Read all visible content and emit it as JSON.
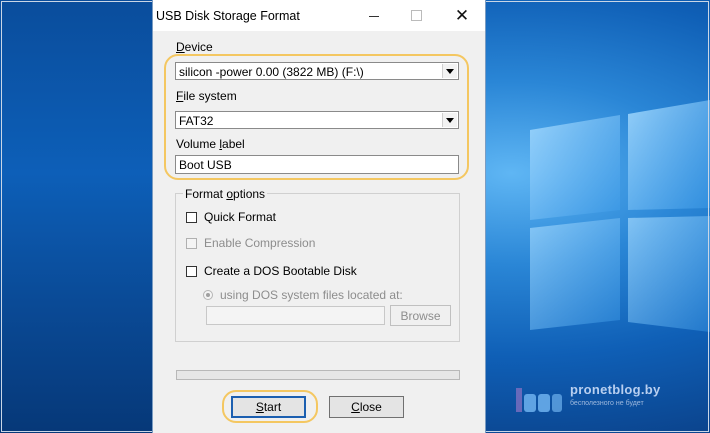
{
  "dialog": {
    "title": "USB Disk Storage Format",
    "device_label": "evice",
    "device_label_mnemonic": "D",
    "device_value": "silicon -power 0.00 (3822 MB) (F:\\)",
    "filesystem_label": "ile system",
    "filesystem_label_mnemonic": "F",
    "filesystem_value": "FAT32",
    "volume_label_prefix": "Volume ",
    "volume_label_mnemonic": "l",
    "volume_label_suffix": "abel",
    "volume_value": "Boot USB",
    "format_options": {
      "title_prefix": "Format ",
      "title_mnemonic": "o",
      "title_suffix": "ptions",
      "quick_format": "Quick Format",
      "enable_compression": "Enable Compression",
      "dos_bootable": "Create a DOS Bootable Disk",
      "dos_files": "using DOS system files located at:",
      "dos_path_value": "",
      "browse": "Browse"
    },
    "progress": 0.0,
    "start_mnemonic": "S",
    "start_suffix": "tart",
    "close_mnemonic": "C",
    "close_suffix": "lose"
  },
  "watermark": {
    "title": "pronetblog.by",
    "subtitle": "бесполезного не будет"
  },
  "colors": {
    "highlight": "#f4c761",
    "accent": "#1c5fb0"
  }
}
